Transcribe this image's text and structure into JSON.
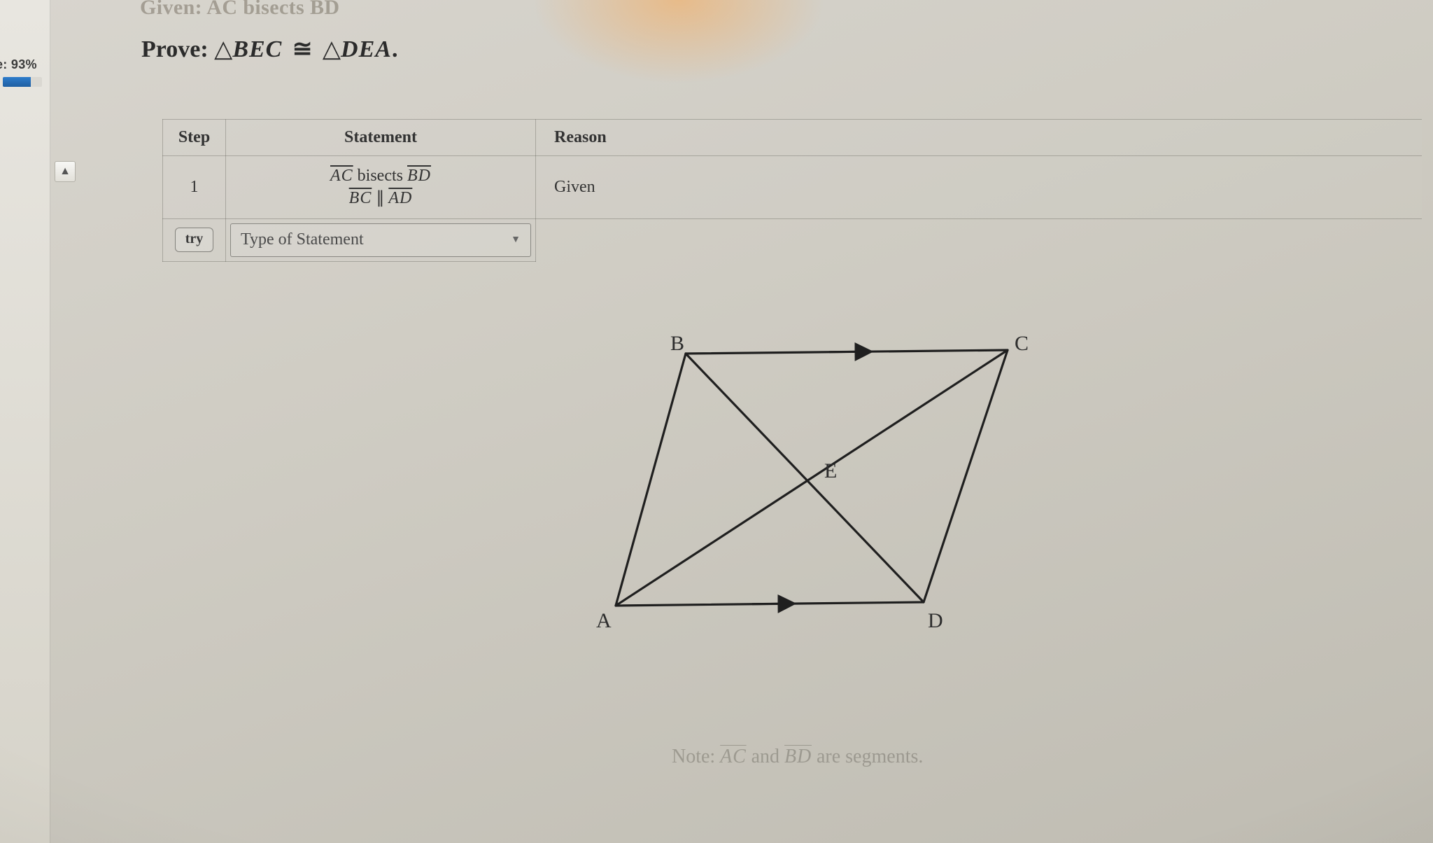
{
  "sidebar": {
    "grade_label": "e: 93%"
  },
  "given_partial": "Given: AC bisects BD",
  "prove": {
    "prefix": "Prove: ",
    "tri1": "BEC",
    "tri2": "DEA"
  },
  "table": {
    "headers": {
      "step": "Step",
      "statement": "Statement",
      "reason": "Reason"
    },
    "row1": {
      "step": "1",
      "stmt_a_left": "AC",
      "stmt_a_mid": " bisects ",
      "stmt_a_right": "BD",
      "stmt_b_left": "BC",
      "stmt_b_mid": " ∥ ",
      "stmt_b_right": "AD",
      "reason": "Given"
    },
    "row_try": {
      "try_label": "try",
      "dropdown_label": "Type of Statement"
    }
  },
  "figure": {
    "labels": {
      "A": "A",
      "B": "B",
      "C": "C",
      "D": "D",
      "E": "E"
    }
  },
  "note": {
    "prefix": "Note: ",
    "seg1": "AC",
    "mid": " and ",
    "seg2": "BD",
    "suffix": " are segments."
  }
}
